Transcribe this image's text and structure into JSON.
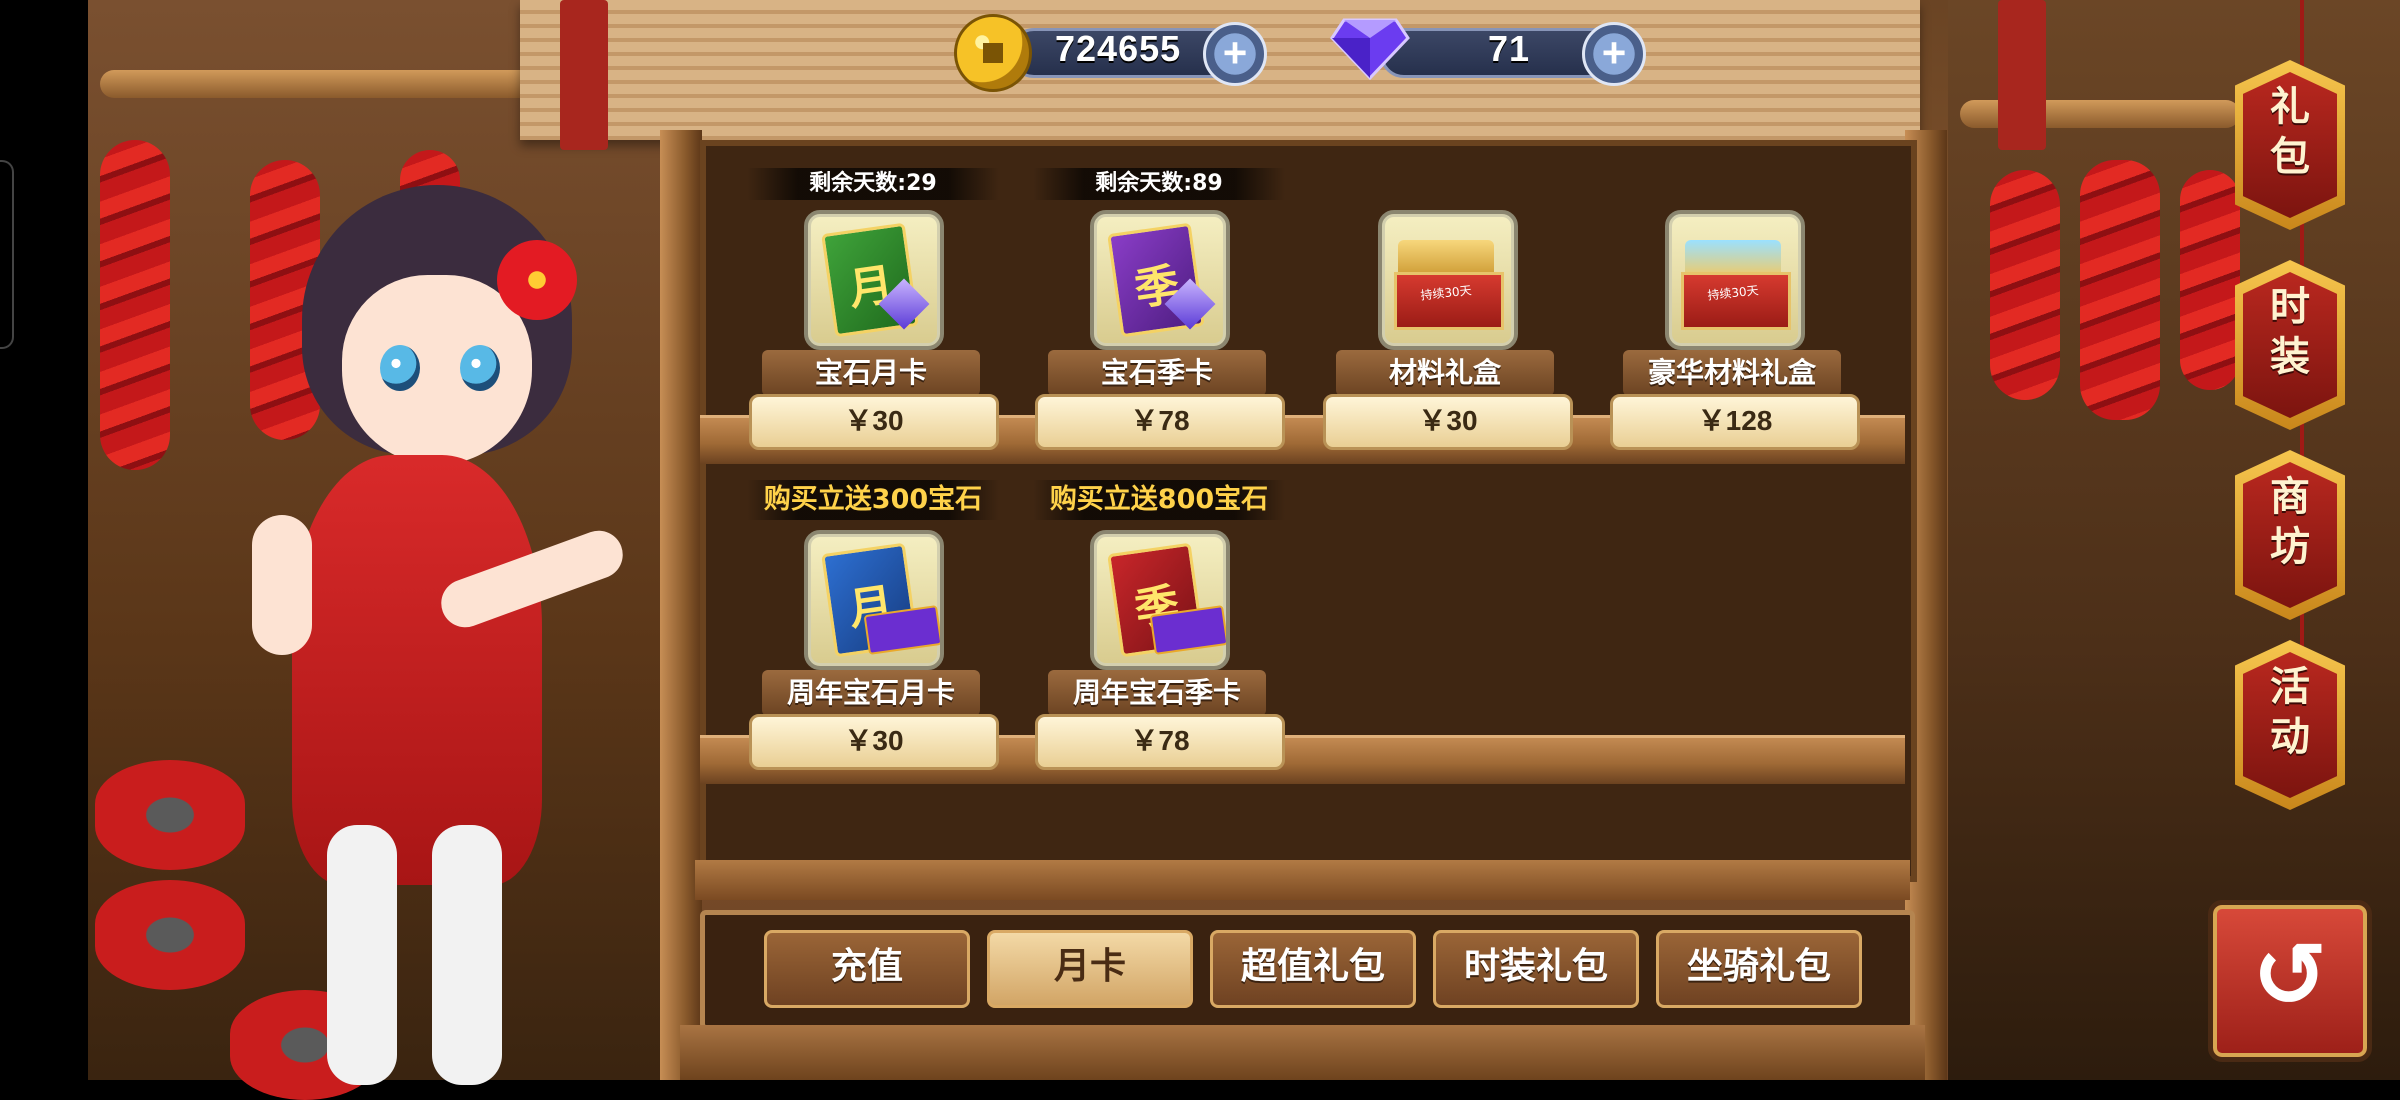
{
  "resources": {
    "coins": {
      "icon": "coin-icon",
      "value": "724655"
    },
    "gems": {
      "icon": "diamond-icon",
      "value": "71"
    }
  },
  "items": [
    {
      "banner": "剩余天数:29",
      "icon": "month-card-icon",
      "card_glyph": "月",
      "name": "宝石月卡",
      "price": "￥30"
    },
    {
      "banner": "剩余天数:89",
      "icon": "season-card-icon",
      "card_glyph": "季",
      "name": "宝石季卡",
      "price": "￥78"
    },
    {
      "banner": "",
      "icon": "material-box-icon",
      "chest_label": "持续30天",
      "name": "材料礼盒",
      "price": "￥30"
    },
    {
      "banner": "",
      "icon": "deluxe-material-box-icon",
      "chest_label": "持续30天",
      "name": "豪华材料礼盒",
      "price": "￥128"
    },
    {
      "banner": "购买立送300宝石",
      "icon": "anniversary-month-card-icon",
      "card_glyph": "月",
      "name": "周年宝石月卡",
      "price": "￥30"
    },
    {
      "banner": "购买立送800宝石",
      "icon": "anniversary-season-card-icon",
      "card_glyph": "季",
      "name": "周年宝石季卡",
      "price": "￥78"
    }
  ],
  "tabs": [
    {
      "label": "充值",
      "active": false
    },
    {
      "label": "月卡",
      "active": true
    },
    {
      "label": "超值礼包",
      "active": false
    },
    {
      "label": "时装礼包",
      "active": false
    },
    {
      "label": "坐骑礼包",
      "active": false
    }
  ],
  "side_tabs": [
    {
      "line1": "礼",
      "line2": "包"
    },
    {
      "line1": "时",
      "line2": "装"
    },
    {
      "line1": "商",
      "line2": "坊"
    },
    {
      "line1": "活",
      "line2": "动"
    }
  ],
  "colors": {
    "accent": "#f6c64e",
    "shelf": "#3f2612",
    "active_tab": "#f3d9a6"
  }
}
